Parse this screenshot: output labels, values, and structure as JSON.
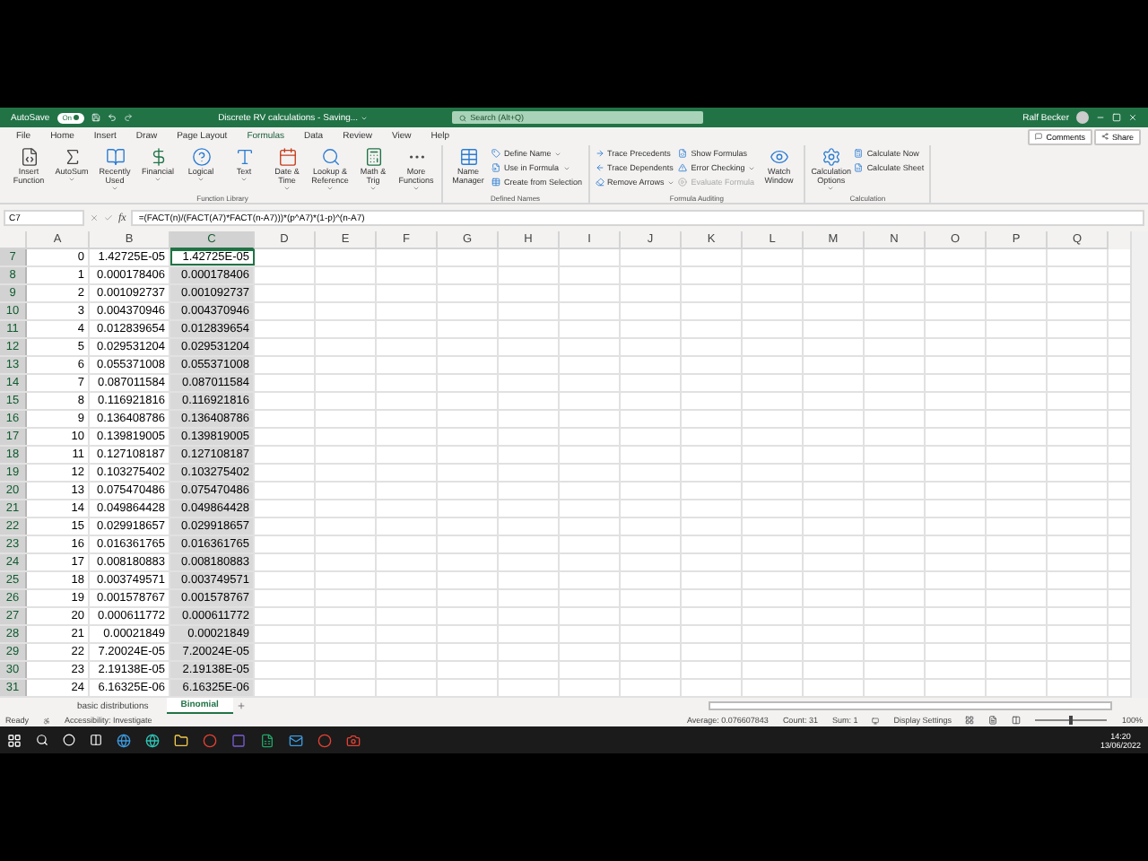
{
  "title_bar": {
    "autosave_label": "AutoSave",
    "autosave": {
      "label": "On",
      "on": true
    },
    "title": "Discrete RV calculations - Saving...",
    "search": {
      "placeholder": "Search (Alt+Q)"
    },
    "user": "Ralf Becker"
  },
  "menu": {
    "tabs": [
      {
        "label": "File",
        "selected": false
      },
      {
        "label": "Home",
        "selected": false
      },
      {
        "label": "Insert",
        "selected": false
      },
      {
        "label": "Draw",
        "selected": false
      },
      {
        "label": "Page Layout",
        "selected": false
      },
      {
        "label": "Formulas",
        "selected": true
      },
      {
        "label": "Data",
        "selected": false
      },
      {
        "label": "Review",
        "selected": false
      },
      {
        "label": "View",
        "selected": false
      },
      {
        "label": "Help",
        "selected": false
      }
    ],
    "comments": "Comments",
    "share": "Share"
  },
  "ribbon": {
    "groups": [
      {
        "label": "Function Library",
        "buttons": [
          {
            "label": "Insert Function",
            "kind": "large",
            "dropdown": false,
            "disabled": false
          },
          {
            "label": "AutoSum",
            "kind": "large",
            "dropdown": true,
            "disabled": false
          },
          {
            "label": "Recently Used",
            "kind": "large",
            "dropdown": true,
            "disabled": false
          },
          {
            "label": "Financial",
            "kind": "large",
            "dropdown": true,
            "disabled": false
          },
          {
            "label": "Logical",
            "kind": "large",
            "dropdown": true,
            "disabled": false
          },
          {
            "label": "Text",
            "kind": "large",
            "dropdown": true,
            "disabled": false
          },
          {
            "label": "Date & Time",
            "kind": "large",
            "dropdown": true,
            "disabled": false
          },
          {
            "label": "Lookup & Reference",
            "kind": "large",
            "dropdown": true,
            "disabled": false
          },
          {
            "label": "Math & Trig",
            "kind": "large",
            "dropdown": true,
            "disabled": false
          },
          {
            "label": "More Functions",
            "kind": "large",
            "dropdown": true,
            "disabled": false
          }
        ]
      },
      {
        "label": "Defined Names",
        "buttons": [
          {
            "label": "Name Manager",
            "kind": "large",
            "dropdown": false,
            "disabled": false
          },
          {
            "label": "Define Name",
            "kind": "small",
            "dropdown": true,
            "disabled": false
          },
          {
            "label": "Use in Formula",
            "kind": "small",
            "dropdown": true,
            "disabled": false
          },
          {
            "label": "Create from Selection",
            "kind": "small",
            "dropdown": false,
            "disabled": false
          }
        ]
      },
      {
        "label": "Formula Auditing",
        "buttons": [
          {
            "label": "Trace Precedents",
            "kind": "small",
            "dropdown": false,
            "disabled": false
          },
          {
            "label": "Trace Dependents",
            "kind": "small",
            "dropdown": false,
            "disabled": false
          },
          {
            "label": "Remove Arrows",
            "kind": "small",
            "dropdown": true,
            "disabled": false
          },
          {
            "label": "Show Formulas",
            "kind": "small",
            "dropdown": false,
            "disabled": false
          },
          {
            "label": "Error Checking",
            "kind": "small",
            "dropdown": true,
            "disabled": false
          },
          {
            "label": "Evaluate Formula",
            "kind": "small",
            "dropdown": false,
            "disabled": true
          },
          {
            "label": "Watch Window",
            "kind": "large",
            "dropdown": false,
            "disabled": false
          }
        ]
      },
      {
        "label": "Calculation",
        "buttons": [
          {
            "label": "Calculation Options",
            "kind": "large",
            "dropdown": true,
            "disabled": false
          },
          {
            "label": "Calculate Now",
            "kind": "small",
            "dropdown": false,
            "disabled": false
          },
          {
            "label": "Calculate Sheet",
            "kind": "small",
            "dropdown": false,
            "disabled": false
          }
        ]
      }
    ]
  },
  "formula_bar": {
    "name_box": "C7",
    "function_button": "fx",
    "formula": "=(FACT(n)/(FACT(A7)*FACT(n-A7)))*(p^A7)*(1-p)^(n-A7)"
  },
  "sheet": {
    "columns": [
      {
        "label": "A",
        "selected": false
      },
      {
        "label": "B",
        "selected": false
      },
      {
        "label": "C",
        "selected": true
      },
      {
        "label": "D",
        "selected": false
      },
      {
        "label": "E",
        "selected": false
      },
      {
        "label": "F",
        "selected": false
      },
      {
        "label": "G",
        "selected": false
      },
      {
        "label": "H",
        "selected": false
      },
      {
        "label": "I",
        "selected": false
      },
      {
        "label": "J",
        "selected": false
      },
      {
        "label": "K",
        "selected": false
      },
      {
        "label": "L",
        "selected": false
      },
      {
        "label": "M",
        "selected": false
      },
      {
        "label": "N",
        "selected": false
      },
      {
        "label": "O",
        "selected": false
      },
      {
        "label": "P",
        "selected": false
      },
      {
        "label": "Q",
        "selected": false
      }
    ],
    "rows": [
      {
        "header": "7",
        "active": true,
        "cells": [
          "0",
          "1.42725E-05",
          "1.42725E-05"
        ]
      },
      {
        "header": "8",
        "active": false,
        "cells": [
          "1",
          "0.000178406",
          "0.000178406"
        ]
      },
      {
        "header": "9",
        "active": false,
        "cells": [
          "2",
          "0.001092737",
          "0.001092737"
        ]
      },
      {
        "header": "10",
        "active": false,
        "cells": [
          "3",
          "0.004370946",
          "0.004370946"
        ]
      },
      {
        "header": "11",
        "active": false,
        "cells": [
          "4",
          "0.012839654",
          "0.012839654"
        ]
      },
      {
        "header": "12",
        "active": false,
        "cells": [
          "5",
          "0.029531204",
          "0.029531204"
        ]
      },
      {
        "header": "13",
        "active": false,
        "cells": [
          "6",
          "0.055371008",
          "0.055371008"
        ]
      },
      {
        "header": "14",
        "active": false,
        "cells": [
          "7",
          "0.087011584",
          "0.087011584"
        ]
      },
      {
        "header": "15",
        "active": false,
        "cells": [
          "8",
          "0.116921816",
          "0.116921816"
        ]
      },
      {
        "header": "16",
        "active": false,
        "cells": [
          "9",
          "0.136408786",
          "0.136408786"
        ]
      },
      {
        "header": "17",
        "active": false,
        "cells": [
          "10",
          "0.139819005",
          "0.139819005"
        ]
      },
      {
        "header": "18",
        "active": false,
        "cells": [
          "11",
          "0.127108187",
          "0.127108187"
        ]
      },
      {
        "header": "19",
        "active": false,
        "cells": [
          "12",
          "0.103275402",
          "0.103275402"
        ]
      },
      {
        "header": "20",
        "active": false,
        "cells": [
          "13",
          "0.075470486",
          "0.075470486"
        ]
      },
      {
        "header": "21",
        "active": false,
        "cells": [
          "14",
          "0.049864428",
          "0.049864428"
        ]
      },
      {
        "header": "22",
        "active": false,
        "cells": [
          "15",
          "0.029918657",
          "0.029918657"
        ]
      },
      {
        "header": "23",
        "active": false,
        "cells": [
          "16",
          "0.016361765",
          "0.016361765"
        ]
      },
      {
        "header": "24",
        "active": false,
        "cells": [
          "17",
          "0.008180883",
          "0.008180883"
        ]
      },
      {
        "header": "25",
        "active": false,
        "cells": [
          "18",
          "0.003749571",
          "0.003749571"
        ]
      },
      {
        "header": "26",
        "active": false,
        "cells": [
          "19",
          "0.001578767",
          "0.001578767"
        ]
      },
      {
        "header": "27",
        "active": false,
        "cells": [
          "20",
          "0.000611772",
          "0.000611772"
        ]
      },
      {
        "header": "28",
        "active": false,
        "cells": [
          "21",
          "0.00021849",
          "0.00021849"
        ]
      },
      {
        "header": "29",
        "active": false,
        "cells": [
          "22",
          "7.20024E-05",
          "7.20024E-05"
        ]
      },
      {
        "header": "30",
        "active": false,
        "cells": [
          "23",
          "2.19138E-05",
          "2.19138E-05"
        ]
      },
      {
        "header": "31",
        "active": false,
        "cells": [
          "24",
          "6.16325E-06",
          "6.16325E-06"
        ]
      }
    ]
  },
  "sheet_tabs": [
    {
      "label": "basic distributions",
      "selected": false
    },
    {
      "label": "Binomial",
      "selected": true
    }
  ],
  "status_bar": {
    "ready": "Ready",
    "accessibility": "Accessibility: Investigate",
    "average": "Average: 0.076607843",
    "count": "Count: 31",
    "sum": "Sum: 1",
    "display_settings": "Display Settings",
    "zoom": {
      "label": "100%",
      "level": 0.5
    }
  },
  "taskbar": {
    "time": "14:20",
    "date": "13/06/2022"
  }
}
